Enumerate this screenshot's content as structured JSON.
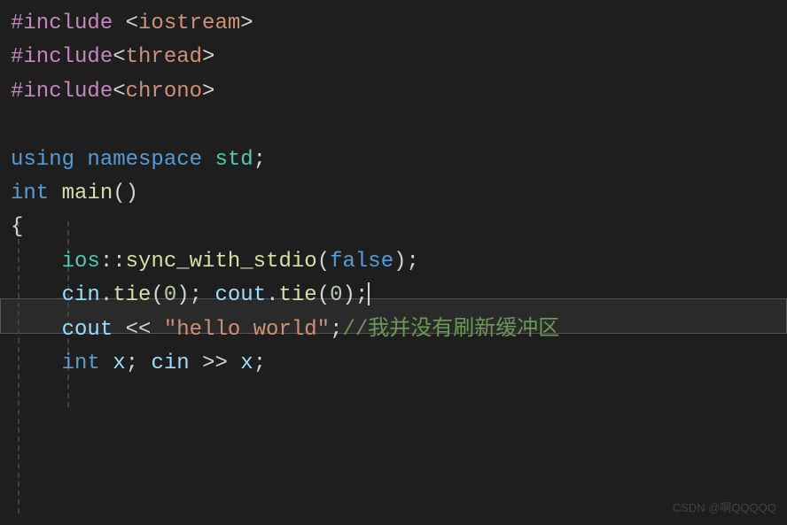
{
  "code": {
    "line1": {
      "directive": "#include",
      "space": " ",
      "open": "<",
      "header": "iostream",
      "close": ">"
    },
    "line2": {
      "directive": "#include",
      "open": "<",
      "header": "thread",
      "close": ">"
    },
    "line3": {
      "directive": "#include",
      "open": "<",
      "header": "chrono",
      "close": ">"
    },
    "line5": {
      "keyword_using": "using",
      "keyword_namespace": "namespace",
      "ns": "std",
      "semi": ";"
    },
    "line6": {
      "type": "int",
      "func": "main",
      "parens": "()"
    },
    "line7": {
      "brace": "{"
    },
    "line8": {
      "ns": "ios",
      "colons": "::",
      "func": "sync_with_stdio",
      "open": "(",
      "arg": "false",
      "close": ")",
      "semi": ";"
    },
    "line9": {
      "obj1": "cin",
      "dot1": ".",
      "func1": "tie",
      "open1": "(",
      "arg1": "0",
      "close1": ")",
      "semi1": ";",
      "space": " ",
      "obj2": "cout",
      "dot2": ".",
      "func2": "tie",
      "open2": "(",
      "arg2": "0",
      "close2": ")",
      "semi2": ";"
    },
    "line10": {
      "obj": "cout",
      "op": " << ",
      "str": "\"hello world\"",
      "semi": ";",
      "comment": "//我并没有刷新缓冲区"
    },
    "line11": {
      "type": "int",
      "var": "x",
      "semi1": ";",
      "obj": "cin",
      "op": " >> ",
      "var2": "x",
      "semi2": ";"
    }
  },
  "watermark": "CSDN @啊QQQQQ"
}
